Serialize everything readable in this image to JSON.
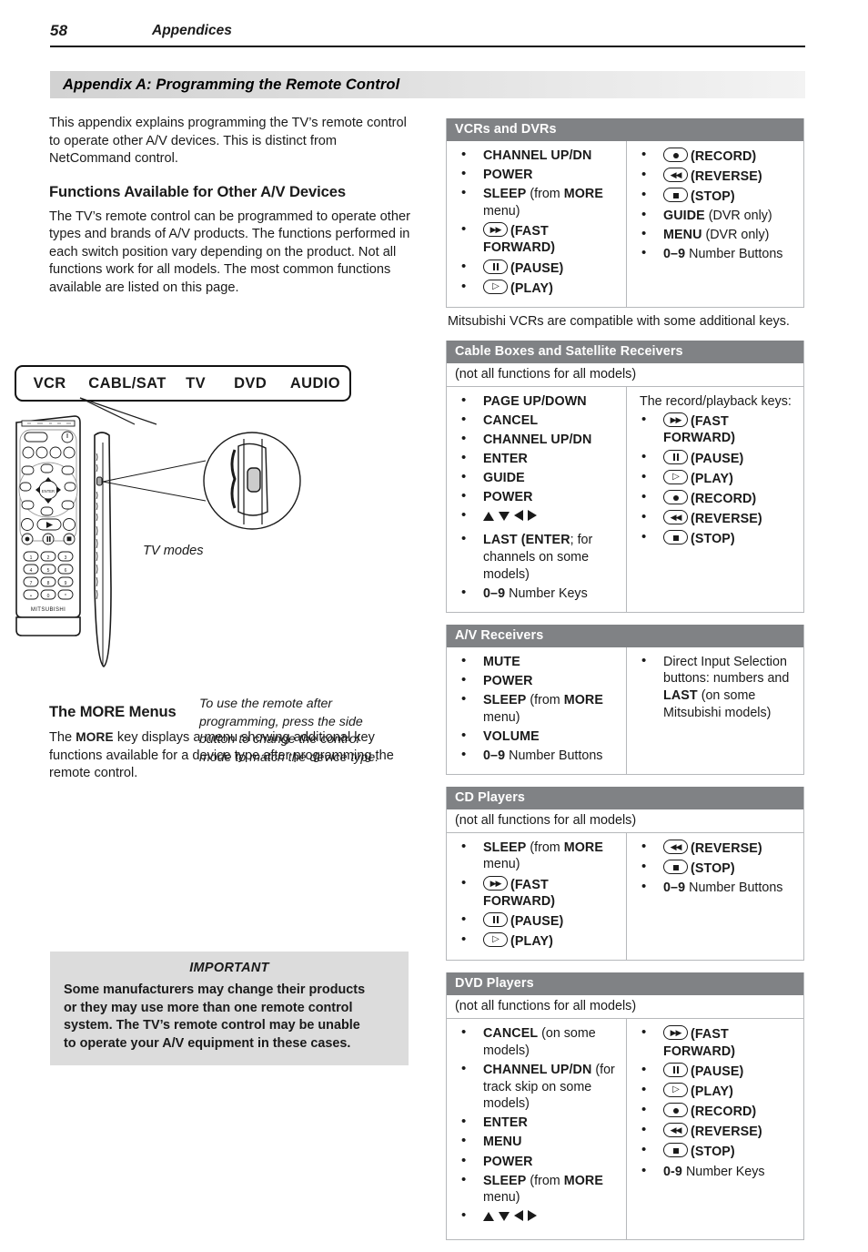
{
  "running_head": {
    "page_number": "58",
    "section": "Appendices"
  },
  "banner": {
    "title": "Appendix A:  Programming the Remote Control"
  },
  "left": {
    "intro": "This appendix explains programming the TV’s remote control to operate other A/V devices.  This is distinct from NetCommand control.",
    "heading_functions": "Functions Available for Other A/V Devices",
    "functions_body": "The TV’s remote control can be programmed to operate other types and brands of A/V products. The functions performed in each switch position vary depending on the product.  Not all functions work for all models.  The most common functions available are listed on this page.",
    "heading_more": "The MORE Menus",
    "more_body_1": "The ",
    "more_key": "MORE",
    "more_body_2": " key displays a menu showing additional key functions available for a device type after programming the remote control."
  },
  "figure": {
    "modes": [
      "VCR",
      "CABL/SAT",
      "TV",
      "DVD",
      "AUDIO"
    ],
    "tv_modes_label": "TV modes",
    "callout": "To use the remote after programming, press the side button to change the control mode to match the device type.",
    "remote_brand": "MITSUBISHI"
  },
  "important": {
    "title": "IMPORTANT",
    "body": "Some manufacturers may change their products or they may use more than one remote control system.  The TV’s remote control may be unable to operate your A/V equipment in these cases."
  },
  "tables": [
    {
      "id": "vcrs-and-dvrs",
      "title": "VCRs and DVRs",
      "note": null,
      "left_items": [
        {
          "icon": null,
          "bold": "CHANNEL UP/DN",
          "rest": ""
        },
        {
          "icon": null,
          "bold": "POWER",
          "rest": ""
        },
        {
          "icon": null,
          "bold": "SLEEP",
          "rest": " (from MORE menu)"
        },
        {
          "icon": "fast-forward",
          "bold": "(FAST FORWARD)",
          "rest": ""
        },
        {
          "icon": "pause",
          "bold": "(PAUSE)",
          "rest": ""
        },
        {
          "icon": "play",
          "bold": "(PLAY)",
          "rest": ""
        }
      ],
      "right_header": null,
      "right_items": [
        {
          "icon": "record",
          "bold": "(RECORD)",
          "rest": ""
        },
        {
          "icon": "reverse",
          "bold": "(REVERSE)",
          "rest": ""
        },
        {
          "icon": "stop",
          "bold": "(STOP)",
          "rest": ""
        },
        {
          "icon": null,
          "bold": "GUIDE",
          "rest": " (DVR only)"
        },
        {
          "icon": null,
          "bold": "MENU",
          "rest": " (DVR only)"
        },
        {
          "icon": null,
          "bold": "0–9",
          "rest": " Number Buttons"
        }
      ],
      "after_note": "Mitsubishi VCRs are compatible with some additional keys."
    },
    {
      "id": "cable-boxes-and-satellite-receivers",
      "title": "Cable Boxes and Satellite Receivers",
      "note": "(not all functions for all models)",
      "left_items": [
        {
          "icon": null,
          "bold": "PAGE UP/DOWN",
          "rest": ""
        },
        {
          "icon": null,
          "bold": "CANCEL",
          "rest": ""
        },
        {
          "icon": null,
          "bold": "CHANNEL UP/DN",
          "rest": ""
        },
        {
          "icon": null,
          "bold": "ENTER",
          "rest": ""
        },
        {
          "icon": null,
          "bold": "GUIDE",
          "rest": ""
        },
        {
          "icon": null,
          "bold": "POWER",
          "rest": ""
        },
        {
          "icon": "arrows",
          "bold": "",
          "rest": ""
        },
        {
          "icon": null,
          "bold": "LAST (ENTER",
          "rest": "; for channels on some models)"
        },
        {
          "icon": null,
          "bold": "0–9",
          "rest": " Number Keys"
        }
      ],
      "right_header": "The record/playback keys:",
      "right_items": [
        {
          "icon": "fast-forward",
          "bold": "(FAST FORWARD)",
          "rest": ""
        },
        {
          "icon": "pause",
          "bold": "(PAUSE)",
          "rest": ""
        },
        {
          "icon": "play",
          "bold": "(PLAY)",
          "rest": ""
        },
        {
          "icon": "record",
          "bold": "(RECORD)",
          "rest": ""
        },
        {
          "icon": "reverse",
          "bold": "(REVERSE)",
          "rest": ""
        },
        {
          "icon": "stop",
          "bold": "(STOP)",
          "rest": ""
        }
      ],
      "after_note": null
    },
    {
      "id": "av-receivers",
      "title": "A/V Receivers",
      "note": null,
      "left_items": [
        {
          "icon": null,
          "bold": "MUTE",
          "rest": ""
        },
        {
          "icon": null,
          "bold": "POWER",
          "rest": ""
        },
        {
          "icon": null,
          "bold": "SLEEP",
          "rest": " (from MORE menu)"
        },
        {
          "icon": null,
          "bold": "VOLUME",
          "rest": ""
        },
        {
          "icon": null,
          "bold": "0–9",
          "rest": " Number Buttons"
        }
      ],
      "right_header": null,
      "right_items": [
        {
          "icon": null,
          "bold": "",
          "rest": "Direct Input Selection buttons:  numbers and LAST (on some Mitsubishi models)"
        }
      ],
      "after_note": null
    },
    {
      "id": "cd-players",
      "title": "CD Players",
      "note": "(not all functions for all models)",
      "left_items": [
        {
          "icon": null,
          "bold": "SLEEP",
          "rest": " (from MORE menu)"
        },
        {
          "icon": "fast-forward",
          "bold": "(FAST FORWARD)",
          "rest": ""
        },
        {
          "icon": "pause",
          "bold": "(PAUSE)",
          "rest": ""
        },
        {
          "icon": "play",
          "bold": "(PLAY)",
          "rest": ""
        }
      ],
      "right_header": null,
      "right_items": [
        {
          "icon": "reverse",
          "bold": "(REVERSE)",
          "rest": ""
        },
        {
          "icon": "stop",
          "bold": "(STOP)",
          "rest": ""
        },
        {
          "icon": null,
          "bold": "0–9",
          "rest": " Number Buttons"
        }
      ],
      "after_note": null
    },
    {
      "id": "dvd-players",
      "title": "DVD Players",
      "note": "(not all functions for all models)",
      "left_items": [
        {
          "icon": null,
          "bold": "CANCEL",
          "rest": " (on some models)"
        },
        {
          "icon": null,
          "bold": "CHANNEL UP/DN",
          "rest": " (for track skip on some models)"
        },
        {
          "icon": null,
          "bold": "ENTER",
          "rest": ""
        },
        {
          "icon": null,
          "bold": "MENU",
          "rest": ""
        },
        {
          "icon": null,
          "bold": "POWER",
          "rest": ""
        },
        {
          "icon": null,
          "bold": "SLEEP",
          "rest": " (from MORE menu)"
        },
        {
          "icon": "arrows",
          "bold": "",
          "rest": ""
        }
      ],
      "right_header": null,
      "right_items": [
        {
          "icon": "fast-forward",
          "bold": "(FAST FORWARD)",
          "rest": ""
        },
        {
          "icon": "pause",
          "bold": "(PAUSE)",
          "rest": ""
        },
        {
          "icon": "play",
          "bold": "(PLAY)",
          "rest": ""
        },
        {
          "icon": "record",
          "bold": "(RECORD)",
          "rest": ""
        },
        {
          "icon": "reverse",
          "bold": "(REVERSE)",
          "rest": ""
        },
        {
          "icon": "stop",
          "bold": "(STOP)",
          "rest": ""
        },
        {
          "icon": null,
          "bold": "0-9",
          "rest": " Number Keys"
        }
      ],
      "after_note": null
    }
  ],
  "colors": {
    "table_header_bg": "#808285",
    "table_border": "#b6b8bb",
    "important_bg": "#dcdcdc",
    "banner_bg": "#dcdcdc"
  }
}
